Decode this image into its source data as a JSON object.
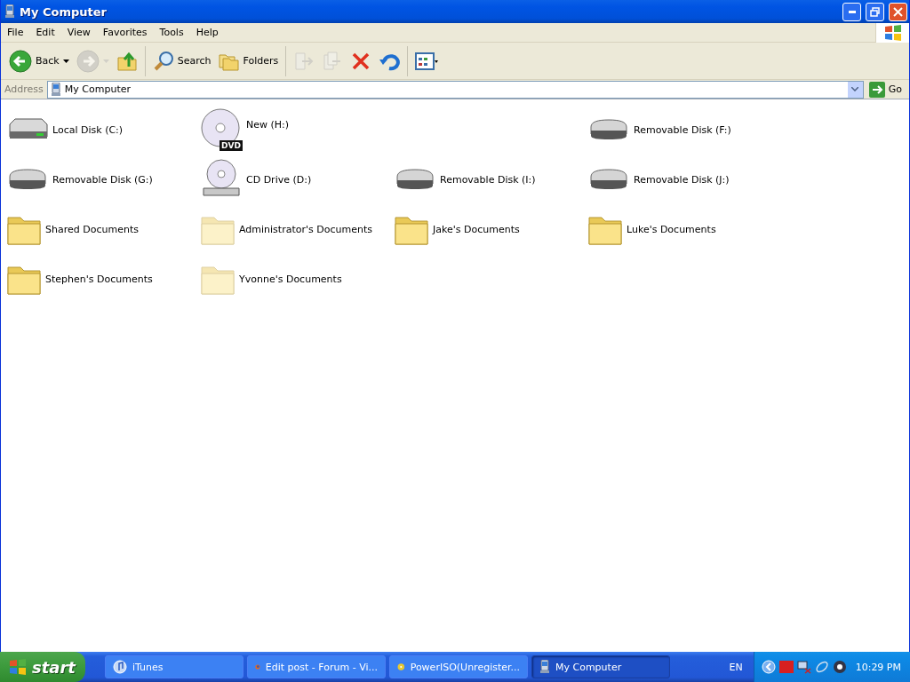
{
  "window": {
    "title": "My Computer"
  },
  "menu": [
    "File",
    "Edit",
    "View",
    "Favorites",
    "Tools",
    "Help"
  ],
  "toolbar": [
    {
      "kind": "back",
      "label": "Back",
      "disabled": false
    },
    {
      "kind": "forward",
      "disabled": true
    },
    {
      "kind": "up",
      "disabled": false
    },
    {
      "kind": "separator"
    },
    {
      "kind": "search",
      "label": "Search",
      "disabled": false
    },
    {
      "kind": "folders",
      "label": "Folders",
      "disabled": false
    },
    {
      "kind": "separator"
    },
    {
      "kind": "moveto",
      "disabled": true
    },
    {
      "kind": "copyto",
      "disabled": true
    },
    {
      "kind": "delete",
      "disabled": false
    },
    {
      "kind": "undo",
      "disabled": false
    },
    {
      "kind": "separator"
    },
    {
      "kind": "views",
      "disabled": false
    }
  ],
  "address": {
    "label": "Address",
    "value": "My Computer",
    "go": "Go"
  },
  "rows": [
    [
      {
        "kind": "hdd",
        "label": "Local Disk (C:)"
      },
      {
        "kind": "dvd",
        "label": "New (H:)",
        "badge": "DVD"
      },
      null,
      {
        "kind": "removable",
        "label": "Removable Disk (F:)"
      }
    ],
    [
      {
        "kind": "removable",
        "label": "Removable Disk (G:)"
      },
      {
        "kind": "cd",
        "label": "CD Drive (D:)"
      },
      {
        "kind": "removable",
        "label": "Removable Disk (I:)"
      },
      {
        "kind": "removable",
        "label": "Removable Disk (J:)"
      }
    ],
    [
      {
        "kind": "folder",
        "label": "Shared Documents",
        "faded": false
      },
      {
        "kind": "folder",
        "label": "Administrator's Documents",
        "faded": true
      },
      {
        "kind": "folder",
        "label": "Jake's Documents",
        "faded": false
      },
      {
        "kind": "folder",
        "label": "Luke's Documents",
        "faded": false
      }
    ],
    [
      {
        "kind": "folder",
        "label": "Stephen's Documents",
        "faded": false
      },
      {
        "kind": "folder",
        "label": "Yvonne's Documents",
        "faded": true
      }
    ]
  ],
  "taskbar": {
    "start": "start",
    "tasks": [
      {
        "kind": "itunes",
        "label": "iTunes",
        "selected": false
      },
      {
        "kind": "browser",
        "label": "Edit post - Forum - Vi...",
        "selected": false
      },
      {
        "kind": "disc",
        "label": "PowerISO(Unregister...",
        "selected": false
      },
      {
        "kind": "computer",
        "label": "My Computer",
        "selected": true
      }
    ],
    "language": "EN",
    "clock": "10:29 PM"
  }
}
